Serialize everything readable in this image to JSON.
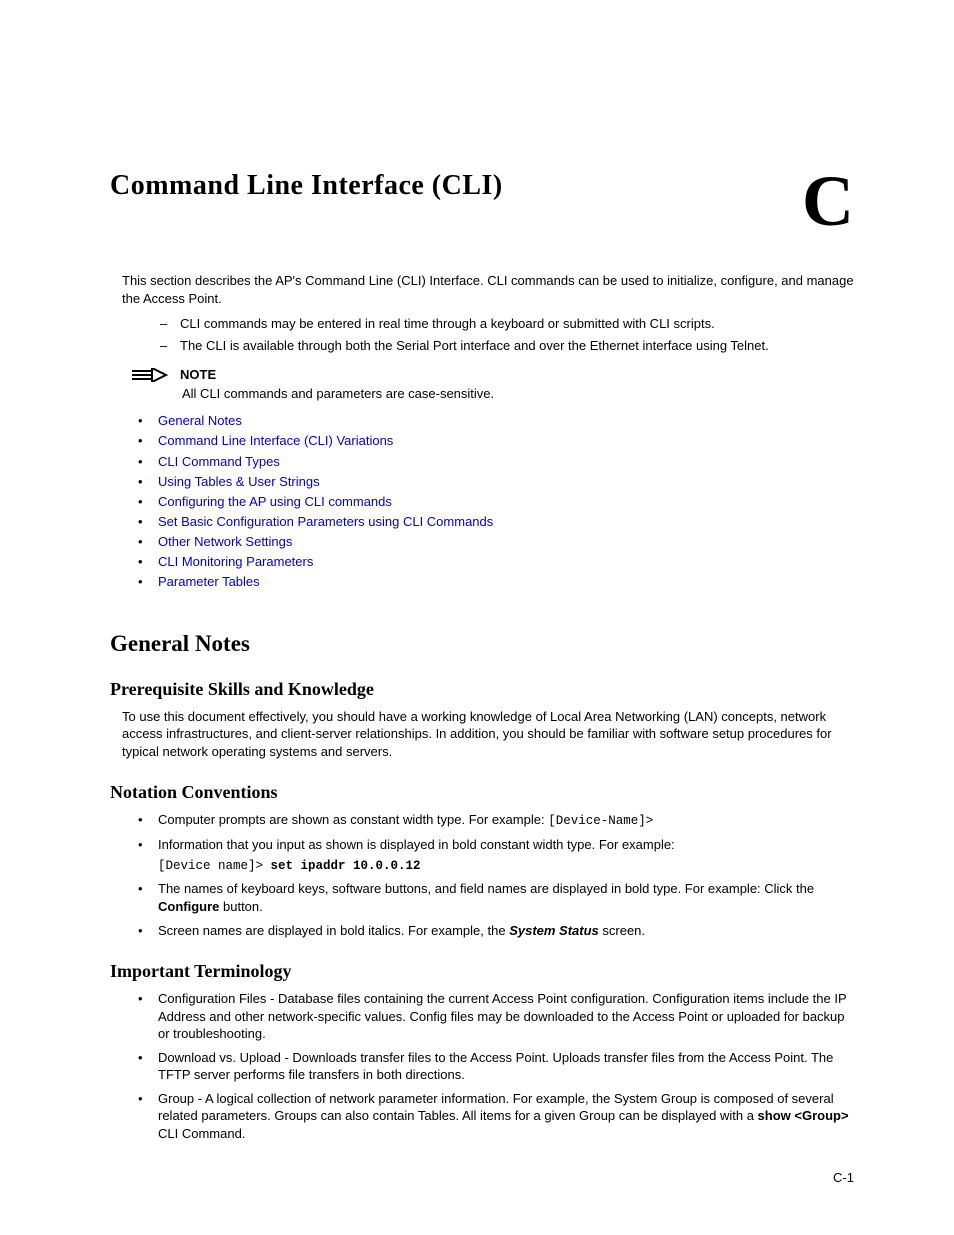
{
  "chapter_letter": "C",
  "chapter_title": "Command Line Interface (CLI)",
  "intro": "This section describes the AP's Command Line (CLI) Interface. CLI commands can be used to initialize, configure, and manage the Access Point.",
  "dash_items": [
    "CLI commands may be entered in real time through a keyboard or submitted with CLI scripts.",
    "The CLI is available through both the Serial Port interface and over the Ethernet interface using Telnet."
  ],
  "note": {
    "label": "NOTE",
    "text": "All CLI commands and parameters are case-sensitive."
  },
  "toc": [
    "General Notes",
    "Command Line Interface (CLI) Variations",
    "CLI Command Types",
    "Using Tables & User Strings",
    "Configuring the AP using CLI commands",
    "Set Basic Configuration Parameters using CLI Commands",
    "Other Network Settings",
    "CLI Monitoring Parameters",
    "Parameter Tables"
  ],
  "sections": {
    "general_notes": {
      "title": "General Notes",
      "prereq": {
        "title": "Prerequisite Skills and Knowledge",
        "text": "To use this document effectively, you should have a working knowledge of Local Area Networking (LAN) concepts, network access infrastructures, and client-server relationships. In addition, you should be familiar with software setup procedures for typical network operating systems and servers."
      },
      "notation": {
        "title": "Notation Conventions",
        "items": {
          "b0": {
            "pre": "Computer prompts are shown as constant width type. For example: ",
            "code": "[Device-Name]>"
          },
          "b1": {
            "pre": "Information that you input as shown is displayed in bold constant width type. For example:",
            "code_prefix": "[Device name]> ",
            "code_bold": "set ipaddr 10.0.0.12"
          },
          "b2": {
            "pre": "The names of keyboard keys, software buttons, and field names are displayed in bold type. For example: Click the ",
            "bold": "Configure",
            "post": " button."
          },
          "b3": {
            "pre": "Screen names are displayed in bold italics. For example, the ",
            "bi": "System Status",
            "post": " screen."
          }
        }
      },
      "terminology": {
        "title": "Important Terminology",
        "items": {
          "t0": "Configuration Files - Database files containing the current Access Point configuration. Configuration items include the IP Address and other network-specific values. Config files may be downloaded to the Access Point or uploaded for backup or troubleshooting.",
          "t1": "Download vs. Upload - Downloads transfer files to the Access Point. Uploads transfer files from the Access Point. The TFTP server performs file transfers in both directions.",
          "t2": {
            "pre": "Group - A logical collection of network parameter information. For example, the System Group is composed of several related parameters. Groups can also contain Tables. All items for a given Group can be displayed with a ",
            "bold": "show <Group>",
            "post": " CLI Command."
          }
        }
      }
    }
  },
  "page_number": "C-1"
}
